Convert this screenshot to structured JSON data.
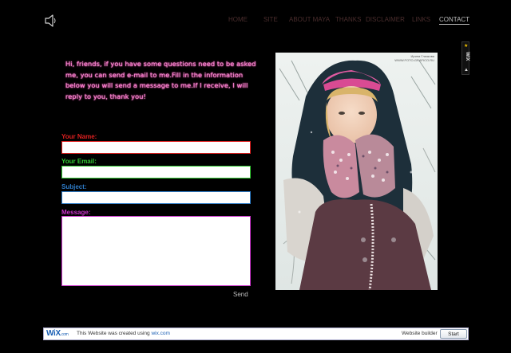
{
  "nav": {
    "items": [
      {
        "label": "HOME"
      },
      {
        "label": "SITE"
      },
      {
        "label": "ABOUT MAYA"
      },
      {
        "label": "THANKS"
      },
      {
        "label": "DISCLAIMER"
      },
      {
        "label": "LINKS"
      },
      {
        "label": "CONTACT",
        "active": true
      }
    ]
  },
  "intro": {
    "text": "Hi, friends, if you have some questions need to be asked me, you can  send e-mail to me.Fill in the information below you will send a message to me.If I receive, I will reply to you, thank you!"
  },
  "form": {
    "name_label": "Your Name:",
    "name_value": "",
    "email_label": "Your Email:",
    "email_value": "",
    "subject_label": "Subject:",
    "subject_value": "",
    "message_label": "Message:",
    "message_value": "",
    "send_label": "Send"
  },
  "photo": {
    "credit_line1": "Ирина Глазкова",
    "credit_line2": "WWW.FOTO-GRAFICO.RU"
  },
  "wix_side": {
    "text": "WIX"
  },
  "wix_bar": {
    "logo": "WiX",
    "logo_suffix": ".com",
    "text": "This Website was created using ",
    "link": "wix.com",
    "builder_label": "Website builder",
    "start_label": "Start"
  },
  "colors": {
    "background": "#000000",
    "intro_text": "#ff7fd4",
    "name_label": "#e02020",
    "email_label": "#33cc33",
    "subject_label": "#2e7cc8",
    "message_label": "#cc33cc",
    "nav_inactive": "#4a2d2d",
    "nav_active": "#bdbdbd"
  }
}
